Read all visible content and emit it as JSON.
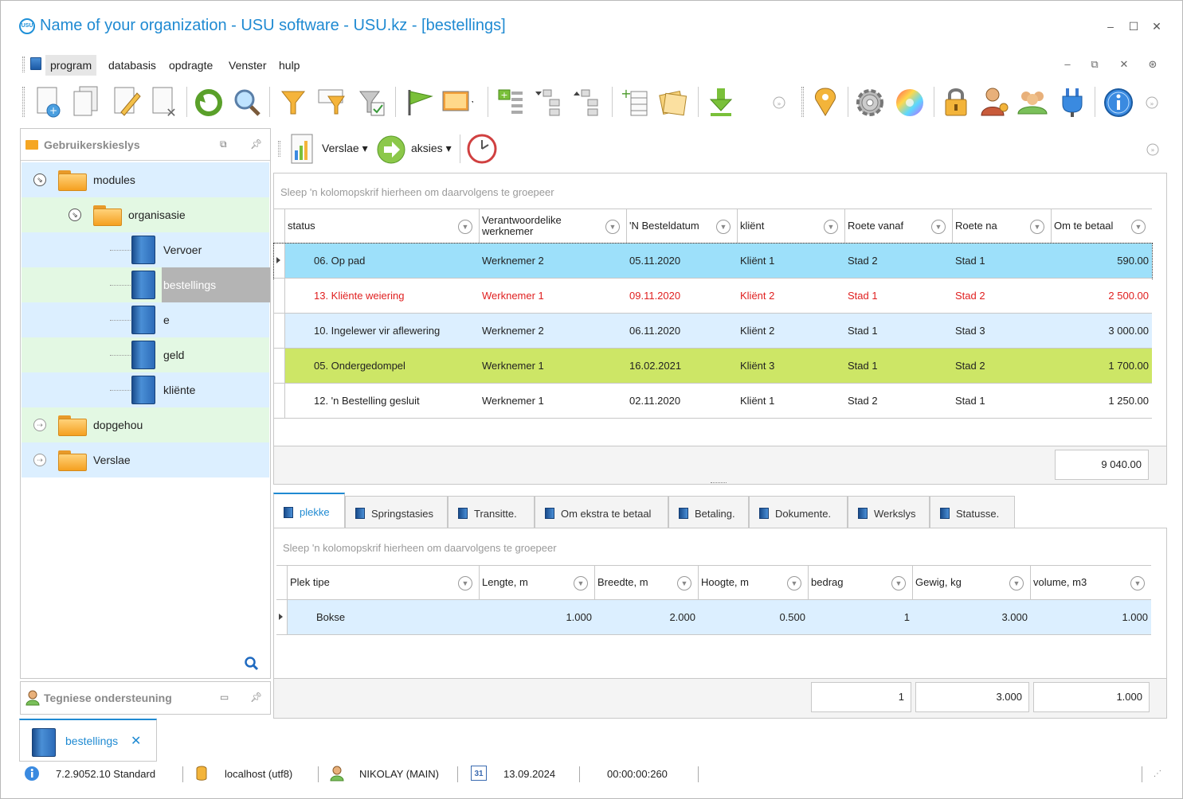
{
  "window": {
    "title": "Name of your organization - USU software - USU.kz - [bestellings]",
    "logo_text": "USU",
    "minimize": "–",
    "maximize": "☐",
    "close": "✕"
  },
  "menu": {
    "items": [
      "program",
      "databasis",
      "opdragte",
      "Venster",
      "hulp"
    ],
    "active_index": 0
  },
  "left_panel": {
    "title": "Gebruikerskieslys",
    "tree": [
      {
        "label": "modules",
        "kind": "folder",
        "expanded": true,
        "level": 0
      },
      {
        "label": "organisasie",
        "kind": "folder",
        "expanded": true,
        "level": 1
      },
      {
        "label": "Vervoer",
        "kind": "book",
        "level": 2
      },
      {
        "label": "bestellings",
        "kind": "book",
        "level": 2,
        "selected": true
      },
      {
        "label": "e",
        "kind": "book",
        "level": 2
      },
      {
        "label": "geld",
        "kind": "book",
        "level": 2
      },
      {
        "label": "kliënte",
        "kind": "book",
        "level": 2
      },
      {
        "label": "dopgehou",
        "kind": "folder",
        "expanded": false,
        "level": 0
      },
      {
        "label": "Verslae",
        "kind": "folder",
        "expanded": false,
        "level": 0
      }
    ]
  },
  "tech_panel": {
    "title": "Tegniese ondersteuning"
  },
  "right_toolbar": {
    "reports_label": "Verslae",
    "actions_label": "aksies"
  },
  "orders_grid": {
    "group_hint": "Sleep 'n kolomopskrif hierheen om daarvolgens te groepeer",
    "columns": [
      "status",
      "Verantwoordelike werknemer",
      "'N Besteldatum",
      "kliënt",
      "Roete vanaf",
      "Roete na",
      "Om te betaal"
    ],
    "rows": [
      {
        "status": "06. Op pad",
        "employee": "Werknemer 2",
        "date": "05.11.2020",
        "client": "Kliënt 1",
        "from": "Stad 2",
        "to": "Stad 1",
        "amount": "590.00",
        "style": "current"
      },
      {
        "status": "13. Kliënte weiering",
        "employee": "Werknemer 1",
        "date": "09.11.2020",
        "client": "Kliënt 2",
        "from": "Stad 1",
        "to": "Stad 2",
        "amount": "2 500.00",
        "style": "red"
      },
      {
        "status": "10. Ingelewer vir aflewering",
        "employee": "Werknemer 2",
        "date": "06.11.2020",
        "client": "Kliënt 2",
        "from": "Stad 1",
        "to": "Stad 3",
        "amount": "3 000.00",
        "style": "lightblue"
      },
      {
        "status": "05. Ondergedompel",
        "employee": "Werknemer 1",
        "date": "16.02.2021",
        "client": "Kliënt 3",
        "from": "Stad 1",
        "to": "Stad 2",
        "amount": "1 700.00",
        "style": "green"
      },
      {
        "status": "12. 'n Bestelling gesluit",
        "employee": "Werknemer 1",
        "date": "02.11.2020",
        "client": "Kliënt 1",
        "from": "Stad 2",
        "to": "Stad 1",
        "amount": "1 250.00",
        "style": "white"
      }
    ],
    "total": "9 040.00"
  },
  "tabs": [
    "plekke",
    "Springstasies",
    "Transitte.",
    "Om ekstra te betaal",
    "Betaling.",
    "Dokumente.",
    "Werkslys",
    "Statusse."
  ],
  "active_tab": 0,
  "places_grid": {
    "group_hint": "Sleep 'n kolomopskrif hierheen om daarvolgens te groepeer",
    "columns": [
      "Plek tipe",
      "Lengte, m",
      "Breedte, m",
      "Hoogte, m",
      "bedrag",
      "Gewig, kg",
      "volume, m3"
    ],
    "rows": [
      {
        "type": "Bokse",
        "length": "1.000",
        "width": "2.000",
        "height": "0.500",
        "amount": "1",
        "weight": "3.000",
        "volume": "1.000"
      }
    ],
    "totals": {
      "amount": "1",
      "weight": "3.000",
      "volume": "1.000"
    }
  },
  "doc_tab": {
    "label": "bestellings",
    "close": "✕"
  },
  "statusbar": {
    "version": "7.2.9052.10 Standard",
    "db": "localhost (utf8)",
    "user": "NIKOLAY (MAIN)",
    "calendar_day": "31",
    "date": "13.09.2024",
    "timer": "00:00:00:260"
  },
  "colors": {
    "accent": "#1f8ad2",
    "current_row": "#9de0fa",
    "red_text": "#e02020",
    "green_row": "#cde666",
    "lightblue_row": "#dcefff"
  }
}
